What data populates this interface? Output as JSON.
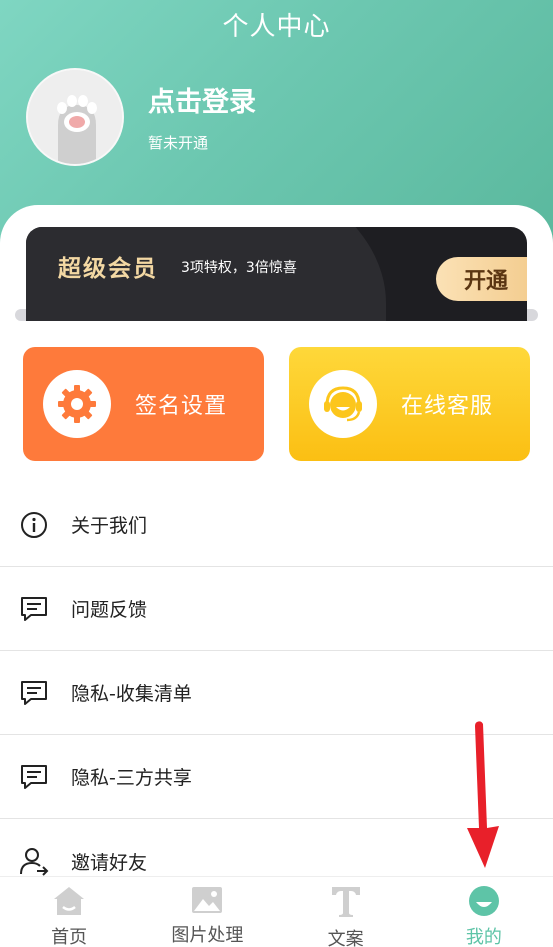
{
  "header": {
    "title": "个人中心",
    "login_label": "点击登录",
    "status_label": "暂未开通"
  },
  "vip": {
    "title": "超级会员",
    "description": "3项特权，3倍惊喜",
    "button_label": "开通"
  },
  "tiles": [
    {
      "label": "签名设置",
      "icon": "gear-icon",
      "color": "#fe7a3b"
    },
    {
      "label": "在线客服",
      "icon": "headset-icon",
      "color": "#fbbf13"
    }
  ],
  "menu": [
    {
      "label": "关于我们",
      "icon": "info-icon"
    },
    {
      "label": "问题反馈",
      "icon": "comment-icon"
    },
    {
      "label": "隐私-收集清单",
      "icon": "comment-icon"
    },
    {
      "label": "隐私-三方共享",
      "icon": "comment-icon"
    },
    {
      "label": "邀请好友",
      "icon": "user-invite-icon"
    }
  ],
  "tabbar": [
    {
      "label": "首页",
      "icon": "home-icon",
      "active": false
    },
    {
      "label": "图片处理",
      "icon": "image-icon",
      "active": false
    },
    {
      "label": "文案",
      "icon": "text-icon",
      "active": false
    },
    {
      "label": "我的",
      "icon": "smile-icon",
      "active": true
    }
  ],
  "colors": {
    "accent": "#5ec4a7",
    "header_gradient_start": "#7fd6c2",
    "header_gradient_end": "#5ab89d",
    "vip_gold": "#f3d8a3",
    "arrow_red": "#e8202a"
  }
}
